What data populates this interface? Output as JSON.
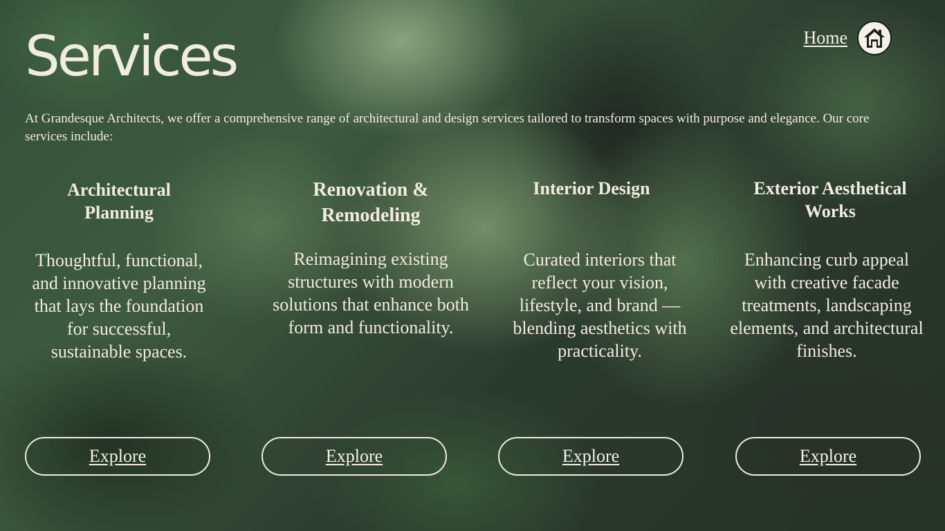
{
  "header": {
    "title": "Services",
    "nav": {
      "home_label": "Home",
      "home_icon": "home-icon"
    }
  },
  "intro": "At Grandesque Architects, we offer a comprehensive range of architectural and design services tailored to transform spaces with purpose and elegance. Our core services include:",
  "services": [
    {
      "title": "Architectural Planning",
      "description": "Thoughtful, functional, and innovative planning that lays the foundation for successful, sustainable spaces.",
      "button_label": "Explore"
    },
    {
      "title": "Renovation & Remodeling",
      "description": "Reimagining existing structures with modern solutions that enhance both form and functionality.",
      "button_label": "Explore"
    },
    {
      "title": "Interior Design",
      "description": "Curated interiors that reflect your vision, lifestyle, and brand — blending aesthetics with practicality.",
      "button_label": "Explore"
    },
    {
      "title": "Exterior Aesthetical Works",
      "description": "Enhancing curb appeal with creative facade treatments, landscaping elements, and architectural finishes.",
      "button_label": "Explore"
    }
  ],
  "colors": {
    "text": "#f1ece0",
    "background_dark": "#263127",
    "background_green": "#3e5a40",
    "icon_circle": "#f4f1ea"
  }
}
